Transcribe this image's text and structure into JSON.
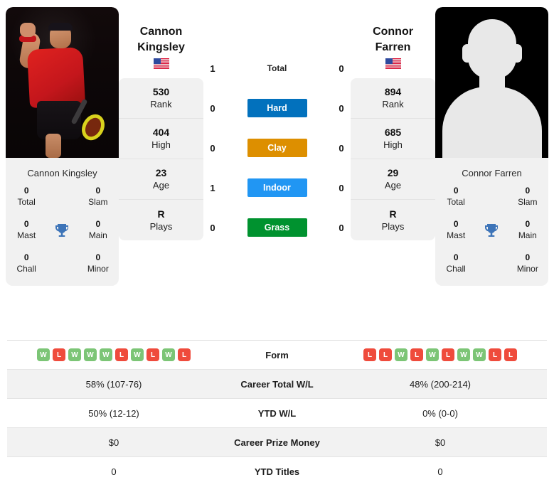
{
  "players": {
    "left": {
      "name": "Cannon Kingsley",
      "name_line1": "Cannon",
      "name_line2": "Kingsley",
      "flag": "US flag",
      "photo_type": "action-photo",
      "card": [
        {
          "value": "530",
          "label": "Rank"
        },
        {
          "value": "404",
          "label": "High"
        },
        {
          "value": "23",
          "label": "Age"
        },
        {
          "value": "R",
          "label": "Plays"
        }
      ],
      "titles": {
        "total": "0",
        "total_label": "Total",
        "slam": "0",
        "slam_label": "Slam",
        "mast": "0",
        "mast_label": "Mast",
        "main": "0",
        "main_label": "Main",
        "chall": "0",
        "chall_label": "Chall",
        "minor": "0",
        "minor_label": "Minor"
      },
      "form": [
        "W",
        "L",
        "W",
        "W",
        "W",
        "L",
        "W",
        "L",
        "W",
        "L"
      ]
    },
    "right": {
      "name": "Connor Farren",
      "name_line1": "Connor",
      "name_line2": "Farren",
      "flag": "US flag",
      "photo_type": "silhouette-placeholder",
      "card": [
        {
          "value": "894",
          "label": "Rank"
        },
        {
          "value": "685",
          "label": "High"
        },
        {
          "value": "29",
          "label": "Age"
        },
        {
          "value": "R",
          "label": "Plays"
        }
      ],
      "titles": {
        "total": "0",
        "total_label": "Total",
        "slam": "0",
        "slam_label": "Slam",
        "mast": "0",
        "mast_label": "Mast",
        "main": "0",
        "main_label": "Main",
        "chall": "0",
        "chall_label": "Chall",
        "minor": "0",
        "minor_label": "Minor"
      },
      "form": [
        "L",
        "L",
        "W",
        "L",
        "W",
        "L",
        "W",
        "W",
        "L",
        "L"
      ]
    }
  },
  "h2h": {
    "rows": [
      {
        "left": "1",
        "label": "Total",
        "right": "0",
        "chip": false,
        "color": ""
      },
      {
        "left": "0",
        "label": "Hard",
        "right": "0",
        "chip": true,
        "color": "#0271bd"
      },
      {
        "left": "0",
        "label": "Clay",
        "right": "0",
        "chip": true,
        "color": "#dd8f00"
      },
      {
        "left": "1",
        "label": "Indoor",
        "right": "0",
        "chip": true,
        "color": "#2196f3"
      },
      {
        "left": "0",
        "label": "Grass",
        "right": "0",
        "chip": true,
        "color": "#00922f"
      }
    ]
  },
  "table": {
    "form_label": "Form",
    "rows": [
      {
        "left": "58% (107-76)",
        "label": "Career Total W/L",
        "right": "48% (200-214)"
      },
      {
        "left": "50% (12-12)",
        "label": "YTD W/L",
        "right": "0% (0-0)"
      },
      {
        "left": "$0",
        "label": "Career Prize Money",
        "right": "$0"
      },
      {
        "left": "0",
        "label": "YTD Titles",
        "right": "0"
      }
    ]
  },
  "colors": {
    "win": "#7cc576",
    "loss": "#ef4b3c",
    "trophy": "#3d74b8",
    "card_bg": "#f1f1f1",
    "stripe": "#f2f2f2"
  },
  "icons": {
    "trophy": "trophy-icon",
    "flag": "us-flag-icon"
  }
}
